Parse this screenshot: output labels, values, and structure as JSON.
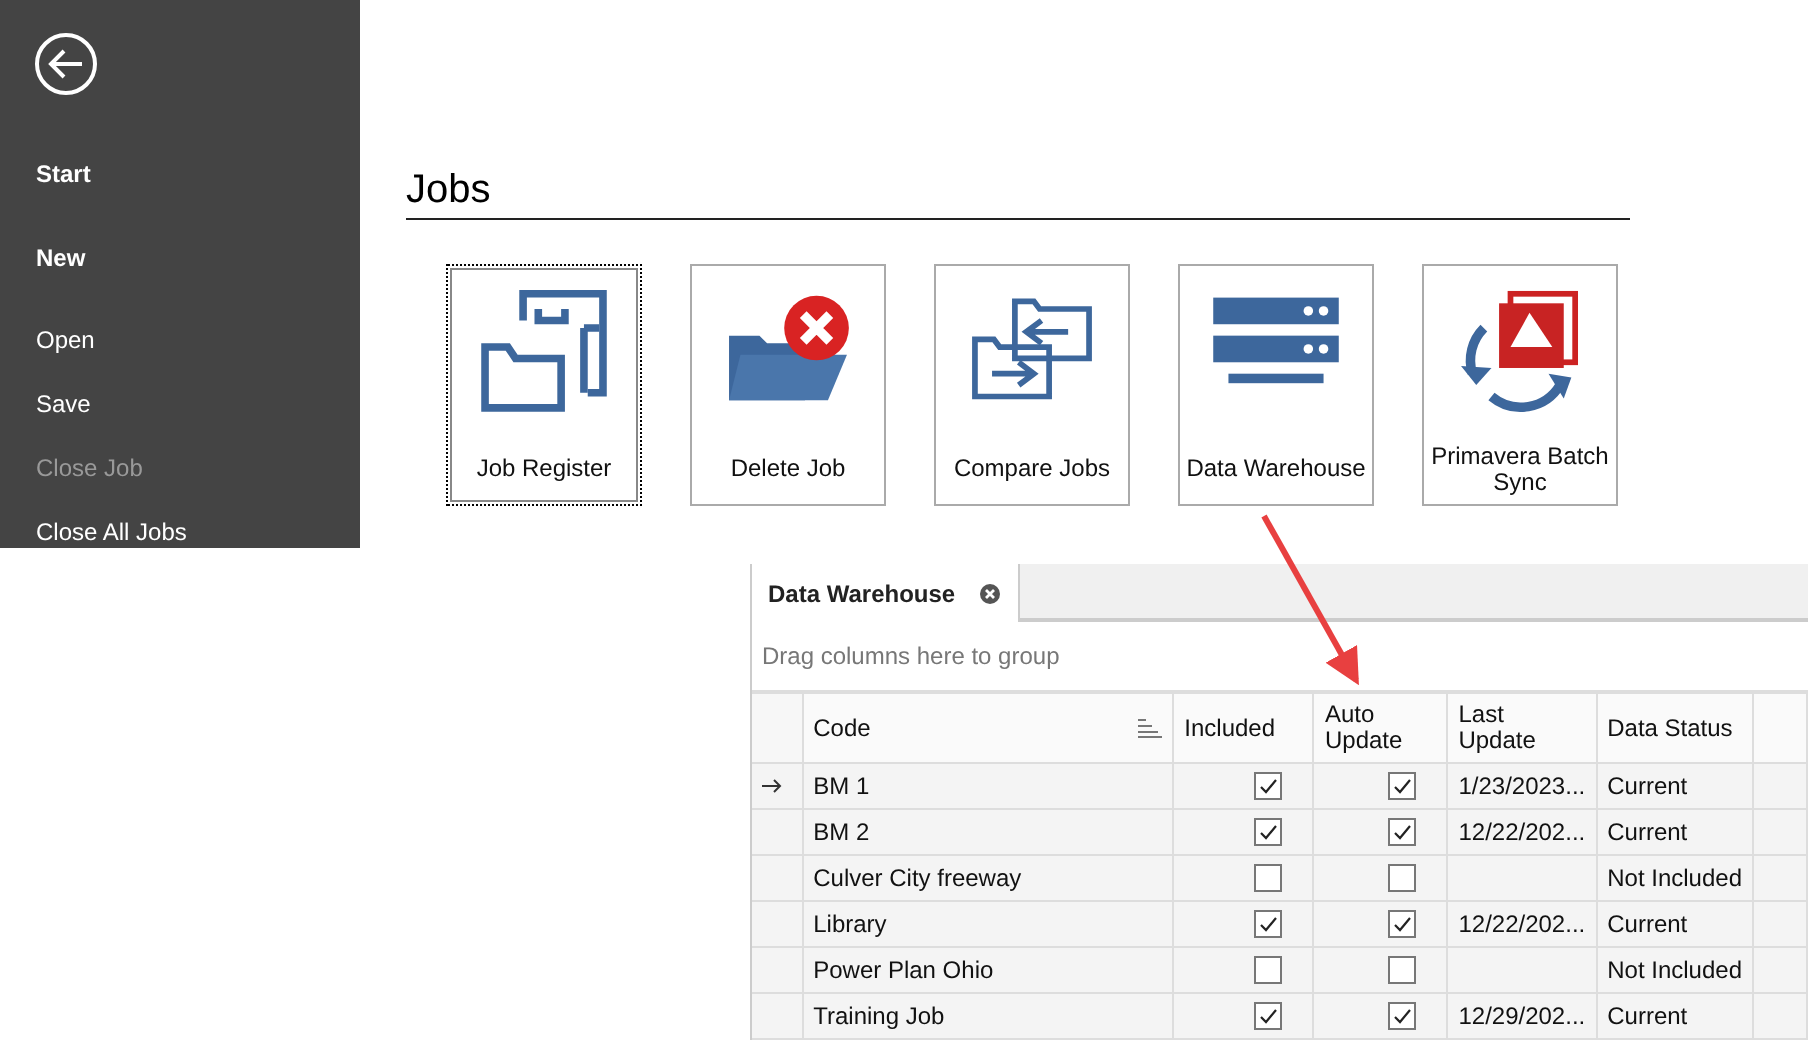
{
  "sidebar": {
    "items": [
      {
        "label": "Start",
        "kind": "heading",
        "disabled": false
      },
      {
        "label": "New",
        "kind": "heading",
        "disabled": false
      },
      {
        "label": "Open",
        "kind": "command",
        "disabled": false
      },
      {
        "label": "Save",
        "kind": "command",
        "disabled": false
      },
      {
        "label": "Close Job",
        "kind": "command",
        "disabled": true
      },
      {
        "label": "Close All Jobs",
        "kind": "command",
        "disabled": false
      }
    ]
  },
  "jobs": {
    "title": "Jobs",
    "tiles": [
      {
        "label": "Job Register",
        "kind": "register",
        "focused": true
      },
      {
        "label": "Delete Job",
        "kind": "delete",
        "focused": false
      },
      {
        "label": "Compare Jobs",
        "kind": "compare",
        "focused": false
      },
      {
        "label": "Data Warehouse",
        "kind": "warehouse",
        "focused": false
      },
      {
        "label": "Primavera Batch Sync",
        "kind": "sync",
        "focused": false
      }
    ]
  },
  "panel": {
    "tab": {
      "label": "Data Warehouse"
    },
    "group_hint": "Drag columns here to group",
    "columns": [
      "Code",
      "Included",
      "Auto Update",
      "Last Update",
      "Data Status"
    ],
    "rows": [
      {
        "code": "BM 1",
        "included": true,
        "auto_update": true,
        "last_update": "1/23/2023...",
        "data_status": "Current",
        "current": true
      },
      {
        "code": "BM 2",
        "included": true,
        "auto_update": true,
        "last_update": "12/22/202...",
        "data_status": "Current",
        "current": false
      },
      {
        "code": "Culver City freeway",
        "included": false,
        "auto_update": false,
        "last_update": "",
        "data_status": "Not Included",
        "current": false
      },
      {
        "code": "Library",
        "included": true,
        "auto_update": true,
        "last_update": "12/22/202...",
        "data_status": "Current",
        "current": false
      },
      {
        "code": "Power Plan Ohio",
        "included": false,
        "auto_update": false,
        "last_update": "",
        "data_status": "Not Included",
        "current": false
      },
      {
        "code": "Training Job",
        "included": true,
        "auto_update": true,
        "last_update": "12/29/202...",
        "data_status": "Current",
        "current": false
      }
    ]
  }
}
